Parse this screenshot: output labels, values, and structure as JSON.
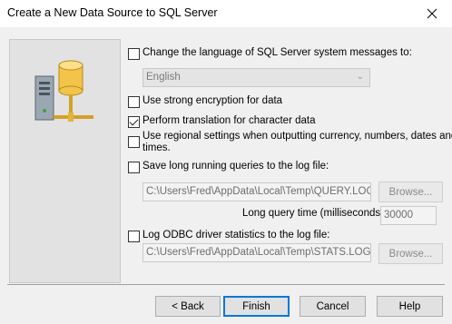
{
  "window": {
    "title": "Create a New Data Source to SQL Server"
  },
  "options": {
    "change_language": {
      "label": "Change the language of SQL Server system messages to:",
      "checked": false
    },
    "language_value": "English",
    "strong_encryption": {
      "label": "Use strong encryption for data",
      "checked": false
    },
    "translation": {
      "label": "Perform translation for character data",
      "checked": true
    },
    "regional": {
      "label_line1": "Use regional settings when outputting currency, numbers, dates and",
      "label_line2": "times.",
      "checked": false
    },
    "long_queries": {
      "label": "Save long running queries to the log file:",
      "checked": false,
      "path": "C:\\Users\\Fred\\AppData\\Local\\Temp\\QUERY.LOG"
    },
    "long_query_time": {
      "label": "Long query time (milliseconds):",
      "value": "30000"
    },
    "driver_stats": {
      "label": "Log ODBC driver statistics to the log file:",
      "checked": false,
      "path": "C:\\Users\\Fred\\AppData\\Local\\Temp\\STATS.LOG"
    }
  },
  "buttons": {
    "browse": "Browse...",
    "back": "< Back",
    "finish": "Finish",
    "cancel": "Cancel",
    "help": "Help"
  }
}
